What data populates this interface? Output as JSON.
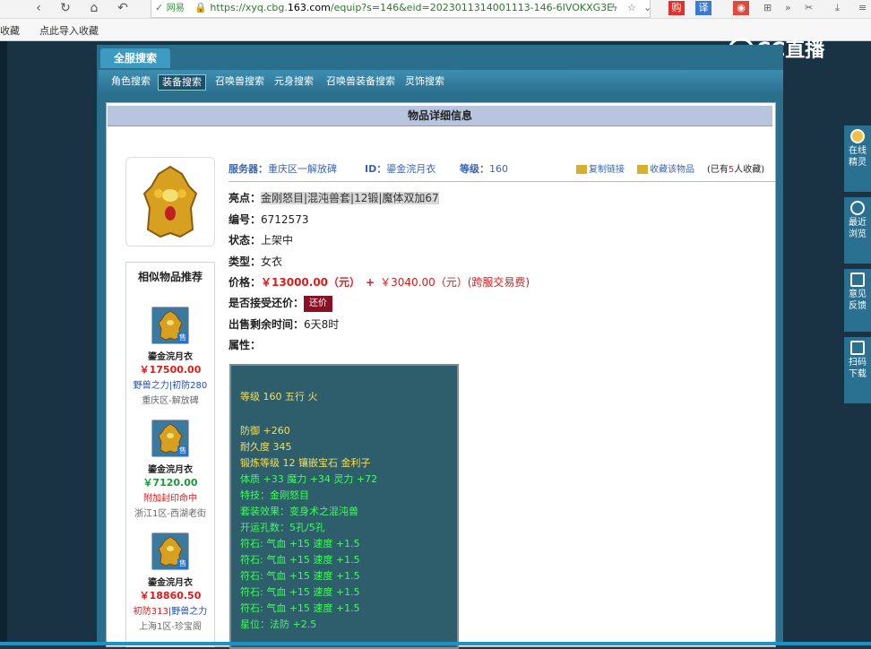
{
  "browser": {
    "safe_label": "网易",
    "url_prefix": "https://xyq.cbg.",
    "url_domain": "163.com",
    "url_suffix": "/equip?s=146&eid=2023011314001113-146-6IVOKXG3E"
  },
  "bookmarks": {
    "item1": "收藏",
    "item2": "点此导入收藏"
  },
  "logo": "CC直播",
  "top_tab": "全服搜索",
  "subnav": [
    "角色搜索",
    "装备搜索",
    "召唤兽搜索",
    "元身搜索",
    "召唤兽装备搜索",
    "灵饰搜索"
  ],
  "section_title": "物品详细信息",
  "info_top": {
    "server_label": "服务器：",
    "server": "重庆区一解放碑",
    "id_label": "ID：",
    "id": "鎏金浣月衣",
    "level_label": "等级：",
    "level": "160",
    "copy_link": "复制链接",
    "collect": "收藏该物品",
    "count_prefix": "(已有",
    "count": "5",
    "count_suffix": "人收藏)"
  },
  "details": {
    "highlight_label": "亮点：",
    "highlight": "金刚怒目|混沌兽套|12锻|魔体双加67",
    "code_label": "编号：",
    "code": "6712573",
    "status_label": "状态：",
    "status": "上架中",
    "type_label": "类型：",
    "type": "女衣",
    "price_label": "价格：",
    "price": "￥13000.00（元）",
    "plus": "+",
    "fee": "￥3040.00（元）(跨服交易费)",
    "counter_label": "是否接受还价：",
    "counter_btn": "还价",
    "remain_label": "出售剩余时间：",
    "remain": "6天8时",
    "attr_label": "属性："
  },
  "attributes": [
    {
      "text": "等级 160 五行 火",
      "color": "yellow"
    },
    {
      "text": "防御 +260",
      "color": "yellow"
    },
    {
      "text": "耐久度 345",
      "color": "yellow"
    },
    {
      "text": "锻炼等级 12 镶嵌宝石 金利子",
      "color": "yellow"
    },
    {
      "text": "体质 +33 魔力 +34 灵力 +72",
      "color": "green"
    },
    {
      "text": "特技：金刚怒目",
      "color": "green"
    },
    {
      "text": "套装效果：变身术之混沌兽",
      "color": "green"
    },
    {
      "text": "开运孔数：5孔/5孔",
      "color": "green"
    },
    {
      "text": "符石: 气血 +15 速度 +1.5",
      "color": "green"
    },
    {
      "text": "符石: 气血 +15 速度 +1.5",
      "color": "green"
    },
    {
      "text": "符石: 气血 +15 速度 +1.5",
      "color": "green"
    },
    {
      "text": "符石: 气血 +15 速度 +1.5",
      "color": "green"
    },
    {
      "text": "符石: 气血 +15 速度 +1.5",
      "color": "green"
    },
    {
      "text": "星位：法防 +2.5",
      "color": "green"
    }
  ],
  "similar": {
    "title": "相似物品推荐",
    "items": [
      {
        "name": "鎏金浣月衣",
        "price": "￥17500.00",
        "tag1": "野兽之力",
        "sep": "|",
        "tag2": "初防280",
        "server": "重庆区-解放碑",
        "sell": "售"
      },
      {
        "name": "鎏金浣月衣",
        "price": "￥7120.00",
        "tag1": "附加封印命中",
        "sep": "",
        "tag2": "",
        "server": "浙江1区-西湖老街",
        "sell": "售"
      },
      {
        "name": "鎏金浣月衣",
        "price": "￥18860.50",
        "tag1": "初防313",
        "sep": "|",
        "tag2": "野兽之力",
        "server": "上海1区-珍宝阁",
        "sell": "售"
      }
    ]
  },
  "side": [
    {
      "l1": "在线",
      "l2": "精灵"
    },
    {
      "l1": "最近",
      "l2": "浏览"
    },
    {
      "l1": "意见",
      "l2": "反馈"
    },
    {
      "l1": "扫码",
      "l2": "下载"
    }
  ]
}
